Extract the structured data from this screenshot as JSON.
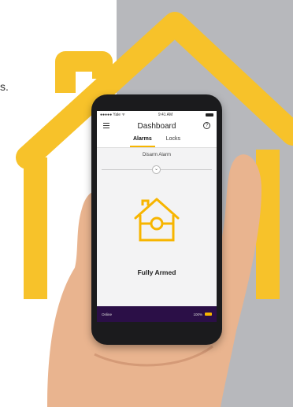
{
  "edge_text": "s.",
  "status": {
    "carrier": "●●●●● Yale ᯤ",
    "time": "9:41 AM"
  },
  "navbar": {
    "title": "Dashboard",
    "help_glyph": "?"
  },
  "tabs": [
    {
      "label": "Alarms",
      "active": true
    },
    {
      "label": "Locks",
      "active": false
    }
  ],
  "disarm_label": "Disarm Alarm",
  "alarm_state": "Fully Armed",
  "footer": {
    "status": "Online",
    "battery": "100%"
  },
  "colors": {
    "accent": "#f7b500",
    "footer_bg": "#2b0f47",
    "panel": "#b7b8bc"
  }
}
